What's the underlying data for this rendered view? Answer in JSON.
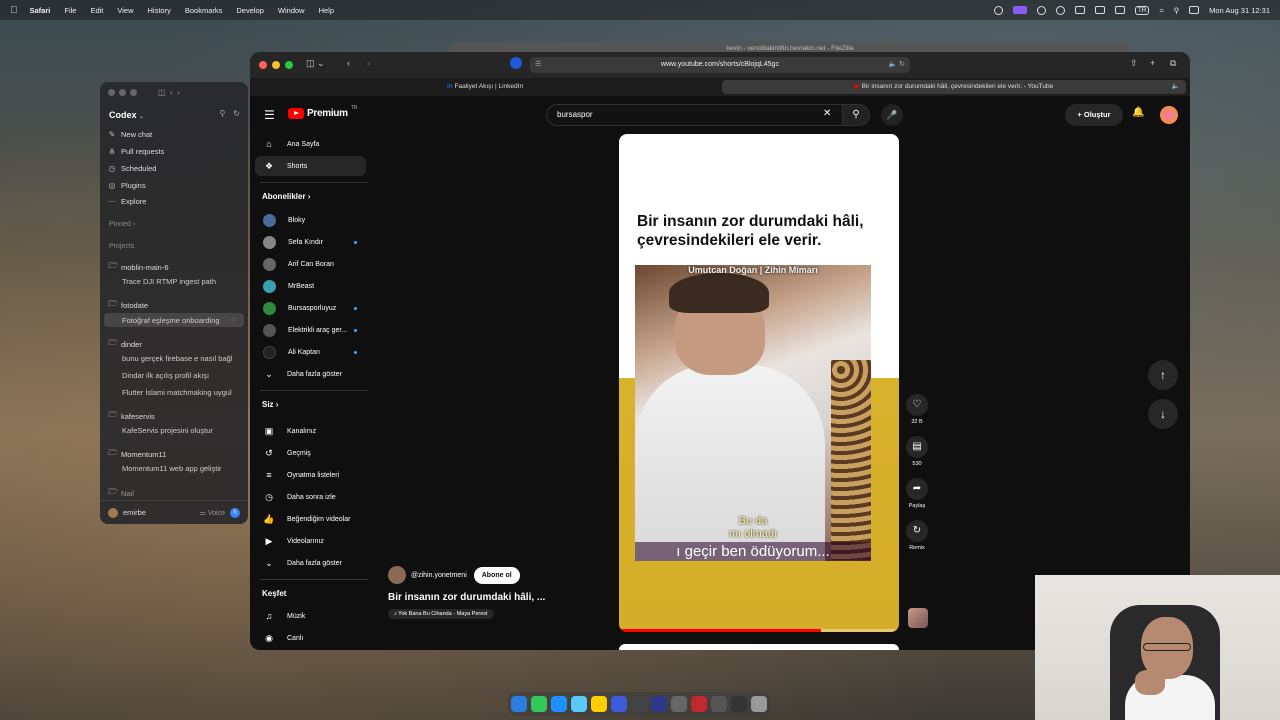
{
  "menubar": {
    "app": "Safari",
    "menus": [
      "File",
      "Edit",
      "View",
      "History",
      "Bookmarks",
      "Develop",
      "Window",
      "Help"
    ],
    "lang": "TR",
    "clock": "Mon Aug 31  12:31"
  },
  "codex": {
    "title": "Codex",
    "nav": [
      "New chat",
      "Pull requests",
      "Scheduled",
      "Plugins",
      "Explore"
    ],
    "pinned": "Pinned",
    "projects_label": "Projects",
    "projects": [
      {
        "name": "moblin-main-6",
        "threads": [
          "Trace DJI RTMP ingest path"
        ]
      },
      {
        "name": "fotodate",
        "threads": [
          "Fotoğraf eşleşme onboarding"
        ]
      },
      {
        "name": "dinder",
        "threads": [
          "bunu gerçek firebase e nasıl bağl",
          "Dindar ilk açılış profil akışı",
          "Flutter İslami matchmaking uygul"
        ]
      },
      {
        "name": "kafeservis",
        "threads": [
          "KafeServis projesini oluştur"
        ]
      },
      {
        "name": "Momentum11",
        "threads": [
          "Momentum11 web app geliştir"
        ]
      },
      {
        "name": "Nail",
        "threads": []
      }
    ],
    "user": "emirbe",
    "voice": "Voice",
    "badge": "6"
  },
  "bg_window_title": "kevin - xenolitakinliftn.hevrakin.net - FileZilla",
  "safari": {
    "url": "www.youtube.com/shorts/cBlojqL45gc",
    "tabs": [
      "Faaliyet Akışı | LinkedIn",
      "Bir insanın zor durumdaki hâli, çevresindekileri ele verir. - YouTube"
    ]
  },
  "youtube": {
    "logo": "Premium",
    "region": "TR",
    "search_value": "bursaspor",
    "create_label": "Oluştur",
    "sidebar": {
      "main": [
        {
          "label": "Ana Sayfa",
          "icon": "home-icon"
        },
        {
          "label": "Shorts",
          "icon": "shorts-icon",
          "selected": true
        }
      ],
      "subs_header": "Abonelikler",
      "subs": [
        {
          "label": "Bloky",
          "color": "#4a6a9a",
          "dot": false
        },
        {
          "label": "Sefa Kındır",
          "color": "#888888",
          "dot": true
        },
        {
          "label": "Arif Can Boran",
          "color": "#666666",
          "dot": false
        },
        {
          "label": "MrBeast",
          "color": "#3aa0b0",
          "dot": false
        },
        {
          "label": "Bursasporluyuz",
          "color": "#2e8b3e",
          "dot": true
        },
        {
          "label": "Elektrikli araç ger...",
          "color": "#555555",
          "dot": true
        },
        {
          "label": "Ali Kaptan",
          "color": "#222222",
          "dot": true
        }
      ],
      "more1": "Daha fazla göster",
      "you_header": "Siz",
      "you": [
        {
          "label": "Kanalınız",
          "icon": "channel-icon"
        },
        {
          "label": "Geçmiş",
          "icon": "history-icon"
        },
        {
          "label": "Oynatma listeleri",
          "icon": "playlist-icon"
        },
        {
          "label": "Daha sonra izle",
          "icon": "clock-icon"
        },
        {
          "label": "Beğendiğim videolar",
          "icon": "like-icon"
        },
        {
          "label": "Videolarınız",
          "icon": "video-icon"
        }
      ],
      "more2": "Daha fazla göster",
      "explore_header": "Keşfet",
      "explore": [
        {
          "label": "Müzik",
          "icon": "music-icon"
        },
        {
          "label": "Canlı",
          "icon": "live-icon"
        }
      ]
    },
    "short": {
      "caption": "Bir insanın zor durumdaki hâli, çevresindekileri ele verir.",
      "clip_banner": "Umutcan Doğan | Zihin Mimarı",
      "subtitle_1": "Bu da\nmı olmadı",
      "subtitle_2": "ı geçir ben ödüyorum...",
      "progress": 0.72,
      "channel": "@zihin.yonetmeni",
      "subscribe": "Abone ol",
      "title": "Bir insanın zor durumdaki hâli, ...",
      "music": "♪ Yok Bana Bu Cihanda · Maya Perest"
    },
    "actions": {
      "likes": "32 B",
      "comments": "530",
      "share": "Paylaş",
      "remix": "Remix"
    }
  }
}
